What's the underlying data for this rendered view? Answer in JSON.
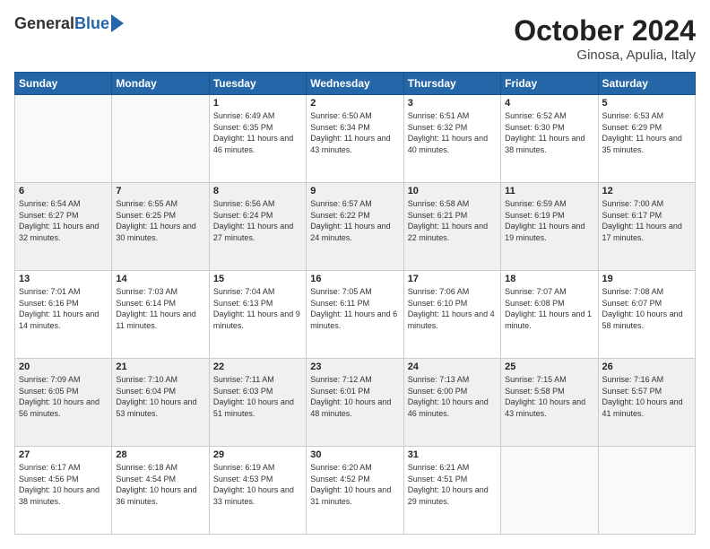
{
  "header": {
    "logo_general": "General",
    "logo_blue": "Blue",
    "month": "October 2024",
    "location": "Ginosa, Apulia, Italy"
  },
  "weekdays": [
    "Sunday",
    "Monday",
    "Tuesday",
    "Wednesday",
    "Thursday",
    "Friday",
    "Saturday"
  ],
  "weeks": [
    {
      "shaded": false,
      "days": [
        {
          "num": "",
          "sunrise": "",
          "sunset": "",
          "daylight": "",
          "empty": true
        },
        {
          "num": "",
          "sunrise": "",
          "sunset": "",
          "daylight": "",
          "empty": true
        },
        {
          "num": "1",
          "sunrise": "Sunrise: 6:49 AM",
          "sunset": "Sunset: 6:35 PM",
          "daylight": "Daylight: 11 hours and 46 minutes.",
          "empty": false
        },
        {
          "num": "2",
          "sunrise": "Sunrise: 6:50 AM",
          "sunset": "Sunset: 6:34 PM",
          "daylight": "Daylight: 11 hours and 43 minutes.",
          "empty": false
        },
        {
          "num": "3",
          "sunrise": "Sunrise: 6:51 AM",
          "sunset": "Sunset: 6:32 PM",
          "daylight": "Daylight: 11 hours and 40 minutes.",
          "empty": false
        },
        {
          "num": "4",
          "sunrise": "Sunrise: 6:52 AM",
          "sunset": "Sunset: 6:30 PM",
          "daylight": "Daylight: 11 hours and 38 minutes.",
          "empty": false
        },
        {
          "num": "5",
          "sunrise": "Sunrise: 6:53 AM",
          "sunset": "Sunset: 6:29 PM",
          "daylight": "Daylight: 11 hours and 35 minutes.",
          "empty": false
        }
      ]
    },
    {
      "shaded": true,
      "days": [
        {
          "num": "6",
          "sunrise": "Sunrise: 6:54 AM",
          "sunset": "Sunset: 6:27 PM",
          "daylight": "Daylight: 11 hours and 32 minutes.",
          "empty": false
        },
        {
          "num": "7",
          "sunrise": "Sunrise: 6:55 AM",
          "sunset": "Sunset: 6:25 PM",
          "daylight": "Daylight: 11 hours and 30 minutes.",
          "empty": false
        },
        {
          "num": "8",
          "sunrise": "Sunrise: 6:56 AM",
          "sunset": "Sunset: 6:24 PM",
          "daylight": "Daylight: 11 hours and 27 minutes.",
          "empty": false
        },
        {
          "num": "9",
          "sunrise": "Sunrise: 6:57 AM",
          "sunset": "Sunset: 6:22 PM",
          "daylight": "Daylight: 11 hours and 24 minutes.",
          "empty": false
        },
        {
          "num": "10",
          "sunrise": "Sunrise: 6:58 AM",
          "sunset": "Sunset: 6:21 PM",
          "daylight": "Daylight: 11 hours and 22 minutes.",
          "empty": false
        },
        {
          "num": "11",
          "sunrise": "Sunrise: 6:59 AM",
          "sunset": "Sunset: 6:19 PM",
          "daylight": "Daylight: 11 hours and 19 minutes.",
          "empty": false
        },
        {
          "num": "12",
          "sunrise": "Sunrise: 7:00 AM",
          "sunset": "Sunset: 6:17 PM",
          "daylight": "Daylight: 11 hours and 17 minutes.",
          "empty": false
        }
      ]
    },
    {
      "shaded": false,
      "days": [
        {
          "num": "13",
          "sunrise": "Sunrise: 7:01 AM",
          "sunset": "Sunset: 6:16 PM",
          "daylight": "Daylight: 11 hours and 14 minutes.",
          "empty": false
        },
        {
          "num": "14",
          "sunrise": "Sunrise: 7:03 AM",
          "sunset": "Sunset: 6:14 PM",
          "daylight": "Daylight: 11 hours and 11 minutes.",
          "empty": false
        },
        {
          "num": "15",
          "sunrise": "Sunrise: 7:04 AM",
          "sunset": "Sunset: 6:13 PM",
          "daylight": "Daylight: 11 hours and 9 minutes.",
          "empty": false
        },
        {
          "num": "16",
          "sunrise": "Sunrise: 7:05 AM",
          "sunset": "Sunset: 6:11 PM",
          "daylight": "Daylight: 11 hours and 6 minutes.",
          "empty": false
        },
        {
          "num": "17",
          "sunrise": "Sunrise: 7:06 AM",
          "sunset": "Sunset: 6:10 PM",
          "daylight": "Daylight: 11 hours and 4 minutes.",
          "empty": false
        },
        {
          "num": "18",
          "sunrise": "Sunrise: 7:07 AM",
          "sunset": "Sunset: 6:08 PM",
          "daylight": "Daylight: 11 hours and 1 minute.",
          "empty": false
        },
        {
          "num": "19",
          "sunrise": "Sunrise: 7:08 AM",
          "sunset": "Sunset: 6:07 PM",
          "daylight": "Daylight: 10 hours and 58 minutes.",
          "empty": false
        }
      ]
    },
    {
      "shaded": true,
      "days": [
        {
          "num": "20",
          "sunrise": "Sunrise: 7:09 AM",
          "sunset": "Sunset: 6:05 PM",
          "daylight": "Daylight: 10 hours and 56 minutes.",
          "empty": false
        },
        {
          "num": "21",
          "sunrise": "Sunrise: 7:10 AM",
          "sunset": "Sunset: 6:04 PM",
          "daylight": "Daylight: 10 hours and 53 minutes.",
          "empty": false
        },
        {
          "num": "22",
          "sunrise": "Sunrise: 7:11 AM",
          "sunset": "Sunset: 6:03 PM",
          "daylight": "Daylight: 10 hours and 51 minutes.",
          "empty": false
        },
        {
          "num": "23",
          "sunrise": "Sunrise: 7:12 AM",
          "sunset": "Sunset: 6:01 PM",
          "daylight": "Daylight: 10 hours and 48 minutes.",
          "empty": false
        },
        {
          "num": "24",
          "sunrise": "Sunrise: 7:13 AM",
          "sunset": "Sunset: 6:00 PM",
          "daylight": "Daylight: 10 hours and 46 minutes.",
          "empty": false
        },
        {
          "num": "25",
          "sunrise": "Sunrise: 7:15 AM",
          "sunset": "Sunset: 5:58 PM",
          "daylight": "Daylight: 10 hours and 43 minutes.",
          "empty": false
        },
        {
          "num": "26",
          "sunrise": "Sunrise: 7:16 AM",
          "sunset": "Sunset: 5:57 PM",
          "daylight": "Daylight: 10 hours and 41 minutes.",
          "empty": false
        }
      ]
    },
    {
      "shaded": false,
      "days": [
        {
          "num": "27",
          "sunrise": "Sunrise: 6:17 AM",
          "sunset": "Sunset: 4:56 PM",
          "daylight": "Daylight: 10 hours and 38 minutes.",
          "empty": false
        },
        {
          "num": "28",
          "sunrise": "Sunrise: 6:18 AM",
          "sunset": "Sunset: 4:54 PM",
          "daylight": "Daylight: 10 hours and 36 minutes.",
          "empty": false
        },
        {
          "num": "29",
          "sunrise": "Sunrise: 6:19 AM",
          "sunset": "Sunset: 4:53 PM",
          "daylight": "Daylight: 10 hours and 33 minutes.",
          "empty": false
        },
        {
          "num": "30",
          "sunrise": "Sunrise: 6:20 AM",
          "sunset": "Sunset: 4:52 PM",
          "daylight": "Daylight: 10 hours and 31 minutes.",
          "empty": false
        },
        {
          "num": "31",
          "sunrise": "Sunrise: 6:21 AM",
          "sunset": "Sunset: 4:51 PM",
          "daylight": "Daylight: 10 hours and 29 minutes.",
          "empty": false
        },
        {
          "num": "",
          "sunrise": "",
          "sunset": "",
          "daylight": "",
          "empty": true
        },
        {
          "num": "",
          "sunrise": "",
          "sunset": "",
          "daylight": "",
          "empty": true
        }
      ]
    }
  ]
}
